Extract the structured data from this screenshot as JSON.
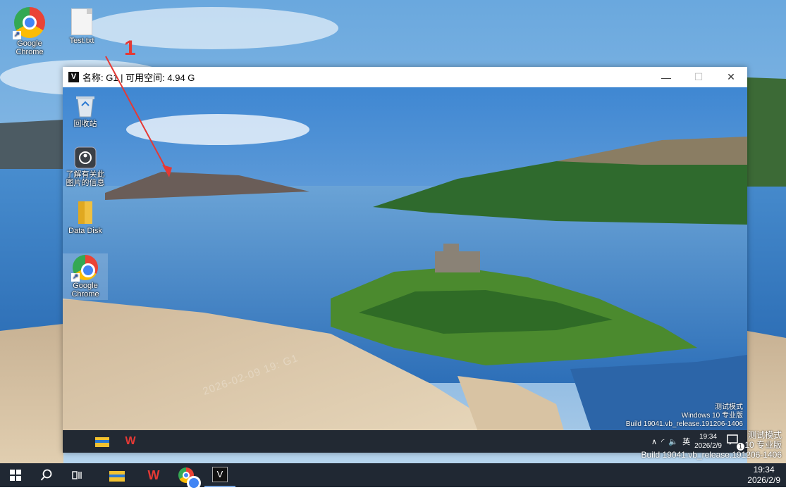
{
  "desktop": {
    "icons": [
      {
        "label": "Google Chrome",
        "icon": "chrome-icon"
      },
      {
        "label": "Test.txt",
        "icon": "text-file-icon"
      }
    ],
    "annotation": "1",
    "watermark": {
      "line1": "测试模式",
      "line2": "10 专业版",
      "line3": "Build 19041.vb_release.191206-1406"
    }
  },
  "window": {
    "app_icon_letter": "V",
    "title": "名称: G1 | 可用空间: 4.94 G",
    "controls": {
      "minimize": "—",
      "maximize": "☐",
      "close": "✕"
    }
  },
  "inner_desktop": {
    "icons": [
      {
        "label": "回收站",
        "icon": "recycle-bin-icon"
      },
      {
        "label": "了解有关此图片的信息",
        "icon": "info-camera-icon"
      },
      {
        "label": "Data Disk",
        "icon": "folder-icon"
      },
      {
        "label": "Google Chrome",
        "icon": "chrome-icon"
      }
    ],
    "stamp": "2026-02-09 19:  G1",
    "watermark": {
      "line1": "测试模式",
      "line2": "Windows 10 专业版",
      "line3": "Build 19041.vb_release.191206-1406"
    },
    "tray": {
      "ime": "英",
      "time": "19:34",
      "date": "2026/2/9",
      "notification_count": "1"
    }
  },
  "taskbar": {
    "items": [
      "start-button",
      "search-button",
      "task-view-button",
      "file-explorer",
      "wps-office",
      "google-chrome",
      "v-app"
    ],
    "clock": {
      "time": "19:34",
      "date": "2026/2/9"
    },
    "v_letter": "V",
    "w_letter": "W"
  }
}
